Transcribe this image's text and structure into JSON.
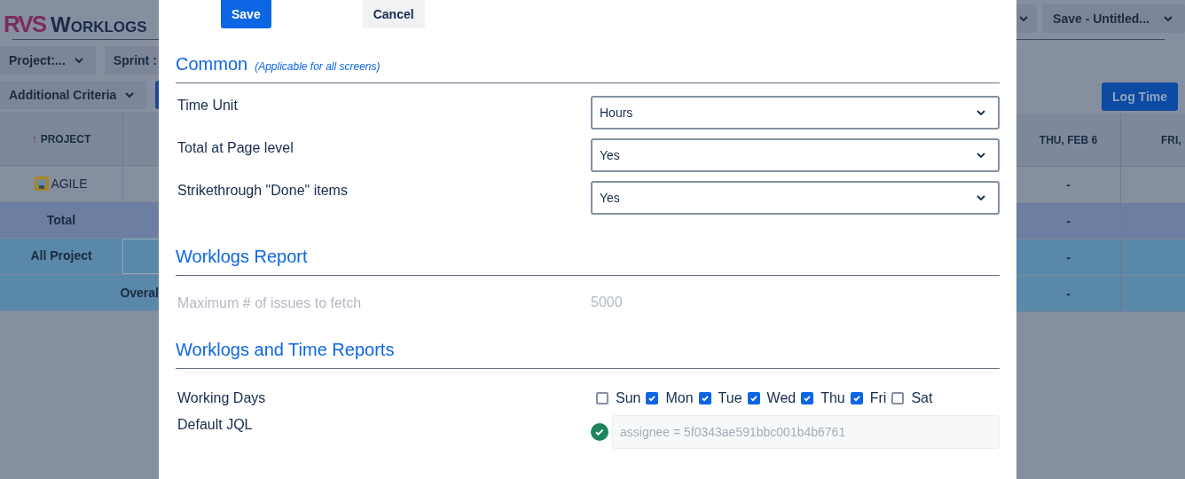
{
  "background": {
    "logo": {
      "mark": "RVS",
      "title": "Worklogs"
    },
    "filters": [
      {
        "label": "Project:...",
        "kind": "dropdown"
      },
      {
        "label": "Sprint :",
        "kind": "text"
      }
    ],
    "criteria": {
      "label": "Additional Criteria"
    },
    "left_table": {
      "header": {
        "arrow": "↑",
        "label": "PROJECT"
      },
      "rows": [
        {
          "kind": "project",
          "label": "AGILE"
        },
        {
          "kind": "total",
          "label": "Total"
        },
        {
          "kind": "group",
          "label": "All Project"
        },
        {
          "kind": "overall",
          "label": "Overal"
        }
      ]
    },
    "save_view": {
      "label": "Save - Untitled..."
    },
    "log_time": {
      "label": "Log Time"
    },
    "right_table": {
      "columns": [
        "THU, FEB 6",
        "FRI,"
      ],
      "rows": [
        {
          "kind": "project",
          "cells": [
            "-",
            ""
          ]
        },
        {
          "kind": "total",
          "cells": [
            "-",
            ""
          ]
        },
        {
          "kind": "group",
          "cells": [
            "-",
            ""
          ]
        },
        {
          "kind": "overall",
          "cells": [
            "-",
            ""
          ]
        }
      ]
    }
  },
  "dialog": {
    "buttons": [
      {
        "label": "Save",
        "kind": "primary"
      },
      {
        "label": "Cancel",
        "kind": "secondary"
      }
    ],
    "sections": [
      {
        "title": "Common",
        "note": "(Applicable for all screens)",
        "rows": [
          {
            "kind": "select",
            "label": "Time Unit",
            "value": "Hours"
          },
          {
            "kind": "select",
            "label": "Total at Page level",
            "value": "Yes"
          },
          {
            "kind": "select",
            "label": "Strikethrough \"Done\" items",
            "value": "Yes"
          }
        ]
      },
      {
        "title": "Worklogs Report",
        "rows": [
          {
            "kind": "readonly",
            "label": "Maximum # of issues to fetch",
            "value": "5000",
            "disabled": true
          }
        ]
      },
      {
        "title": "Worklogs and Time Reports",
        "rows": [
          {
            "kind": "weekdays",
            "label": "Working Days",
            "days": [
              {
                "label": "Sun",
                "checked": false
              },
              {
                "label": "Mon",
                "checked": true
              },
              {
                "label": "Tue",
                "checked": true
              },
              {
                "label": "Wed",
                "checked": true
              },
              {
                "label": "Thu",
                "checked": true
              },
              {
                "label": "Fri",
                "checked": true
              },
              {
                "label": "Sat",
                "checked": false
              }
            ]
          },
          {
            "kind": "jql",
            "label": "Default JQL",
            "value": "assignee = 5f0343ae591bbc001b4b6761",
            "valid": true,
            "disabled": true
          }
        ]
      }
    ]
  }
}
